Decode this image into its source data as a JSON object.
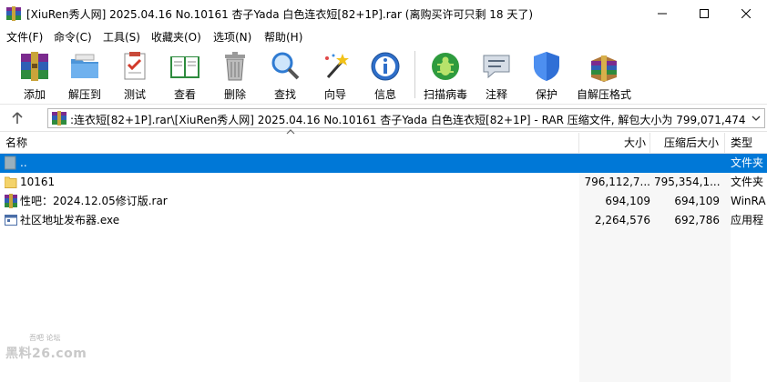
{
  "window": {
    "title": "[XiuRen秀人网] 2025.04.16 No.10161 杏子Yada 白色连衣短[82+1P].rar (离购买许可只剩 18 天了)",
    "minimize_glyph": "—",
    "maximize_glyph": "☐",
    "close_glyph": "✕"
  },
  "menu": [
    "文件(F)",
    "命令(C)",
    "工具(S)",
    "收藏夹(O)",
    "选项(N)",
    "帮助(H)"
  ],
  "toolbar": [
    {
      "label": "添加",
      "icon": "add-archive-icon"
    },
    {
      "label": "解压到",
      "icon": "extract-to-icon"
    },
    {
      "label": "测试",
      "icon": "test-icon"
    },
    {
      "label": "查看",
      "icon": "view-icon"
    },
    {
      "label": "删除",
      "icon": "delete-icon"
    },
    {
      "label": "查找",
      "icon": "find-icon"
    },
    {
      "label": "向导",
      "icon": "wizard-icon"
    },
    {
      "label": "信息",
      "icon": "info-icon"
    },
    {
      "label": "扫描病毒",
      "icon": "virus-scan-icon"
    },
    {
      "label": "注释",
      "icon": "comment-icon"
    },
    {
      "label": "保护",
      "icon": "protect-icon"
    },
    {
      "label": "自解压格式",
      "icon": "sfx-icon"
    }
  ],
  "address": {
    "text": ":连衣短[82+1P].rar\\[XiuRen秀人网] 2025.04.16 No.10161 杏子Yada 白色连衣短[82+1P] - RAR 压缩文件, 解包大小为 799,071,474 字节"
  },
  "columns": {
    "name": "名称",
    "size": "大小",
    "packed": "压缩后大小",
    "type": "类型"
  },
  "files": [
    {
      "name": "..",
      "size": "",
      "packed": "",
      "type": "文件夹",
      "icon": "parent-folder-icon",
      "selected": true
    },
    {
      "name": "10161",
      "size": "796,112,7...",
      "packed": "795,354,1...",
      "type": "文件夹",
      "icon": "folder-icon",
      "selected": false
    },
    {
      "name": "性吧：2024.12.05修订版.rar",
      "size": "694,109",
      "packed": "694,109",
      "type": "WinRA",
      "icon": "rar-file-icon",
      "selected": false
    },
    {
      "name": "社区地址发布器.exe",
      "size": "2,264,576",
      "packed": "692,786",
      "type": "应用程",
      "icon": "exe-file-icon",
      "selected": false
    }
  ],
  "watermark": {
    "top": "吾吧 论坛",
    "main": "黑料26.com"
  }
}
